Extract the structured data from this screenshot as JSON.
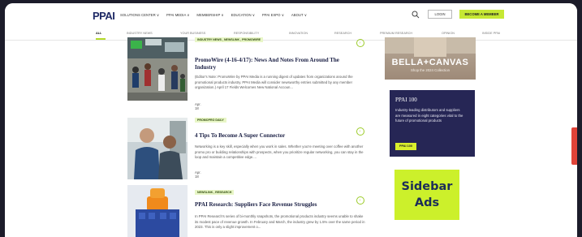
{
  "header": {
    "logo": "PPAI",
    "nav": [
      "SOLUTIONS CENTER ∨",
      "PPAI MEDIA ∨",
      "MEMBERSHIP ∨",
      "EDUCATION ∨",
      "PPAI EXPO ∨",
      "ABOUT ∨"
    ],
    "login_label": "LOGIN",
    "member_label": "BECOME A MEMBER"
  },
  "subnav": [
    "ALL",
    "INDUSTRY NEWS",
    "YOUR BUSINESS",
    "RESPONSIBILITY",
    "INNOVATION",
    "RESEARCH",
    "PREMIUM RESEARCH",
    "OPINION",
    "INSIDE PPAI"
  ],
  "articles": [
    {
      "tag": "INDUSTRY NEWS , NEWSLINK , PROMOWIRE",
      "title": "PromoWire (4-16-4/17): News And Notes From Around The Industry",
      "excerpt": "(Editor's Note: PromoWire by PPAI Media is a running digest of updates from organizations around the promotional products industry. PPAI Media will consider newsworthy entries submitted by any member organization.) April 17 Fields Welcomes New National Accoun...",
      "date": "Apr. 18"
    },
    {
      "tag": "PROMOPRO DAILY",
      "title": "4 Tips To Become A Super Connector",
      "excerpt": "Networking is a key skill, especially when you work in sales. Whether you're meeting over coffee with another promo pro or building relationships with prospects, when you prioritize regular networking, you can stay in the loop and maintain a competitive edge....",
      "date": "Apr. 18"
    },
    {
      "tag": "NEWSLINK , RESEARCH",
      "title": "PPAI Research: Suppliers Face Revenue Struggles",
      "excerpt": "In PPAI Research's series of bi-monthly snapshots, the promotional products industry seems unable to shake its modest pace of revenue growth. In February and March, the industry grew by 1.5% over the same period in 2023. This is only a slight improvement o...",
      "date": ""
    }
  ],
  "sidebar": {
    "bella_title": "BELLA+CANVAS",
    "bella_sub": "Shop the 2024 Collection",
    "ppai100_title": "PPAI 100",
    "ppai100_text": "Industry-leading distributors and suppliers are measured in eight categories vital to the future of promotional products",
    "ppai100_button": "PPAI 100",
    "ads_line1": "Sidebar",
    "ads_line2": "Ads"
  },
  "colors": {
    "accent": "#c6e834",
    "navy": "#262655",
    "frame": "#1c1c2a"
  }
}
